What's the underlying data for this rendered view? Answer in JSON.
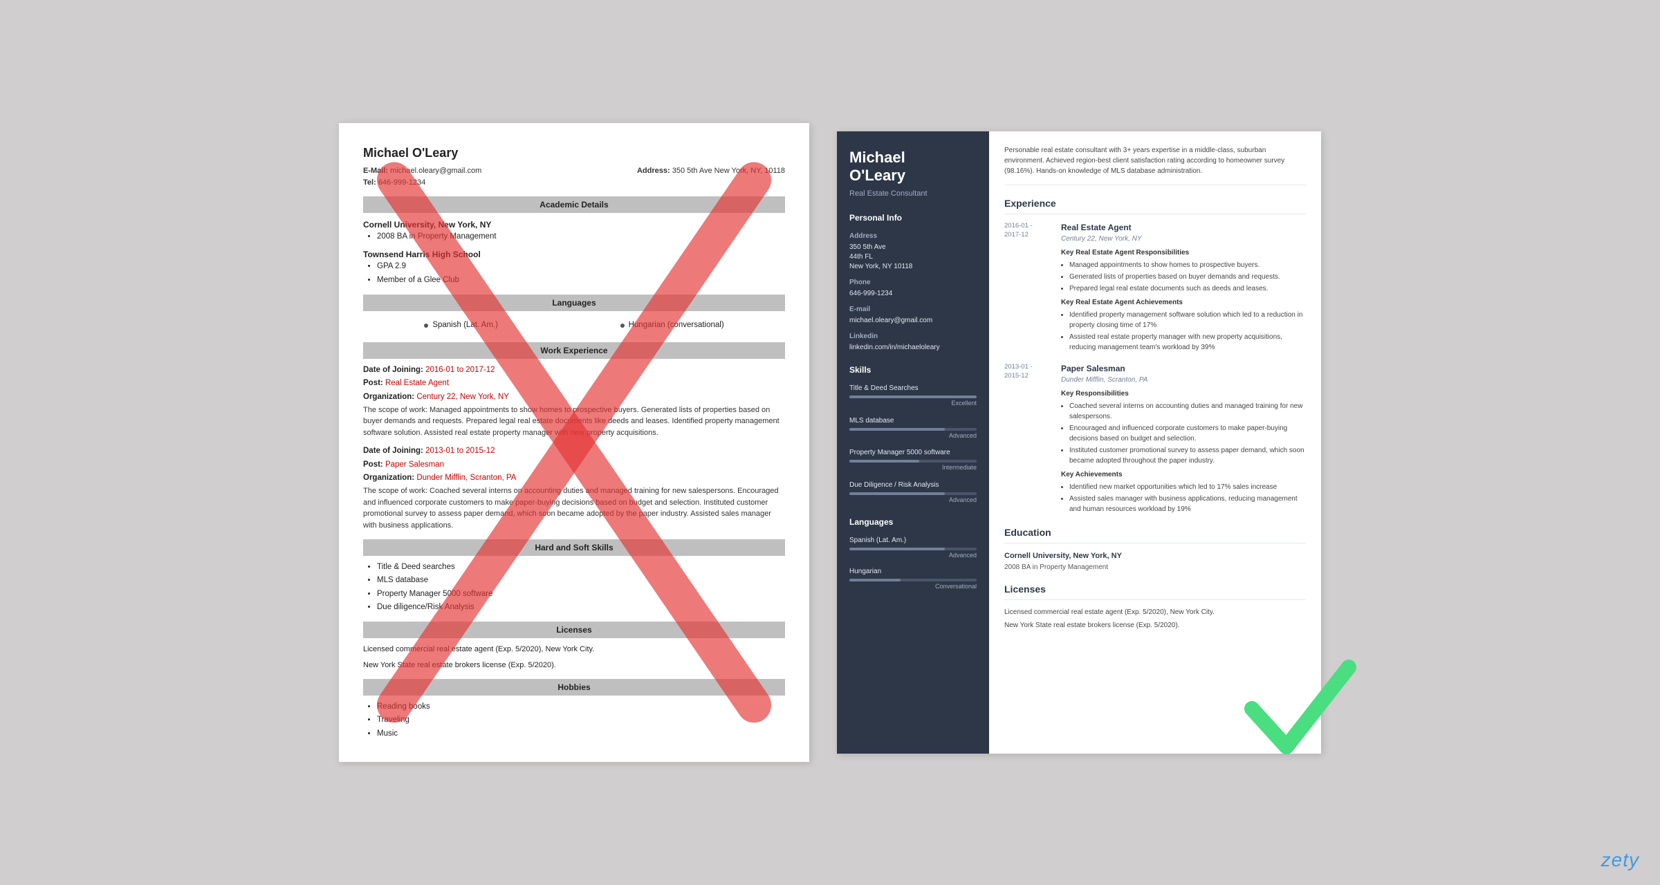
{
  "left_resume": {
    "name": "Michael O'Leary",
    "email_label": "E-Mail:",
    "email": "michael.oleary@gmail.com",
    "address_label": "Address:",
    "address": "350 5th Ave New York, NY, 10118",
    "tel_label": "Tel:",
    "tel": "646-999-1234",
    "sections": {
      "academic": "Academic Details",
      "languages": "Languages",
      "work": "Work Experience",
      "skills": "Hard and Soft Skills",
      "licenses": "Licenses",
      "hobbies": "Hobbies"
    },
    "education": [
      {
        "school": "Cornell University, New York, NY",
        "items": [
          "2008 BA in Property Management"
        ]
      },
      {
        "school": "Townsend Harris High School",
        "items": [
          "GPA 2.9",
          "Member of a Glee Club"
        ]
      }
    ],
    "languages": [
      "Spanish (Lat. Am.)",
      "Hungarian (conversational)"
    ],
    "work": [
      {
        "date_label": "Date of Joining:",
        "date": "2016-01 to 2017-12",
        "post_label": "Post:",
        "post": "Real Estate Agent",
        "org_label": "Organization:",
        "org": "Century 22, New York, NY",
        "scope_label": "The scope of work:",
        "scope": "Managed appointments to show homes to prospective buyers. Generated lists of properties based on buyer demands and requests. Prepared legal real estate documents like deeds and leases. Identified property management software solution. Assisted real estate property manager with new property acquisitions."
      },
      {
        "date_label": "Date of Joining:",
        "date": "2013-01 to 2015-12",
        "post_label": "Post:",
        "post": "Paper Salesman",
        "org_label": "Organization:",
        "org": "Dunder Mifflin, Scranton, PA",
        "scope_label": "The scope of work:",
        "scope": "Coached several interns on accounting duties and managed training for new salespersons. Encouraged and influenced corporate customers to make paper-buying decisions based on budget and selection. Instituted customer promotional survey to assess paper demand, which soon became adopted by the paper industry. Assisted sales manager with business applications."
      }
    ],
    "skills": [
      "Title & Deed searches",
      "MLS database",
      "Property Manager 5000 software",
      "Due diligence/Risk Analysis"
    ],
    "licenses": [
      "Licensed commercial real estate agent (Exp. 5/2020), New York City.",
      "New York State real estate brokers license (Exp. 5/2020)."
    ],
    "hobbies": [
      "Reading books",
      "Traveling",
      "Music"
    ]
  },
  "right_resume": {
    "name": "Michael\nO'Leary",
    "title": "Real Estate Consultant",
    "sidebar": {
      "personal_section": "Personal Info",
      "address_label": "Address",
      "address": "350 5th Ave\n44th FL\nNew York, NY 10118",
      "phone_label": "Phone",
      "phone": "646-999-1234",
      "email_label": "E-mail",
      "email": "michael.oleary@gmail.com",
      "linkedin_label": "Linkedin",
      "linkedin": "linkedin.com/in/michaeloleary",
      "skills_section": "Skills",
      "skills": [
        {
          "name": "Title & Deed Searches",
          "pct": 100,
          "level": "Excellent"
        },
        {
          "name": "MLS database",
          "pct": 75,
          "level": "Advanced"
        },
        {
          "name": "Property Manager 5000 software",
          "pct": 55,
          "level": "Intermediate"
        },
        {
          "name": "Due Diligence / Risk Analysis",
          "pct": 75,
          "level": "Advanced"
        }
      ],
      "languages_section": "Languages",
      "languages": [
        {
          "name": "Spanish (Lat. Am.)",
          "pct": 75,
          "level": "Advanced"
        },
        {
          "name": "Hungarian",
          "pct": 40,
          "level": "Conversational"
        }
      ]
    },
    "main": {
      "summary": "Personable real estate consultant with 3+ years expertise in a middle-class, suburban environment. Achieved region-best client satisfaction rating according to homeowner survey (98.16%). Hands-on knowledge of MLS database administration.",
      "experience_title": "Experience",
      "experience": [
        {
          "start": "2016-01 -",
          "end": "2017-12",
          "job_title": "Real Estate Agent",
          "company": "Century 22, New York, NY",
          "responsibilities_title": "Key Real Estate Agent Responsibilities",
          "responsibilities": [
            "Managed appointments to show homes to prospective buyers.",
            "Generated lists of properties based on buyer demands and requests.",
            "Prepared legal real estate documents such as deeds and leases."
          ],
          "achievements_title": "Key Real Estate Agent Achievements",
          "achievements": [
            "Identified property management software solution which led to a reduction in property closing time of 17%",
            "Assisted real estate property manager with new property acquisitions, reducing management team's workload by 39%"
          ]
        },
        {
          "start": "2013-01 -",
          "end": "2015-12",
          "job_title": "Paper Salesman",
          "company": "Dunder Mifflin, Scranton, PA",
          "responsibilities_title": "Key Responsibilities",
          "responsibilities": [
            "Coached several interns on accounting duties and managed training for new salespersons.",
            "Encouraged and influenced corporate customers to make paper-buying decisions based on budget and selection.",
            "Instituted customer promotional survey to assess paper demand, which soon became adopted throughout the paper industry."
          ],
          "achievements_title": "Key Achievements",
          "achievements": [
            "Identified new market opportunities which led to 17% sales increase",
            "Assisted sales manager with business applications, reducing management and human resources workload by 19%"
          ]
        }
      ],
      "education_title": "Education",
      "education": [
        {
          "school": "Cornell University, New York, NY",
          "degree": "2008 BA in Property Management"
        }
      ],
      "licenses_title": "Licenses",
      "licenses": [
        "Licensed commercial real estate agent (Exp. 5/2020), New York City.",
        "New York State real estate brokers license (Exp. 5/2020)."
      ]
    }
  },
  "brand": "zety"
}
